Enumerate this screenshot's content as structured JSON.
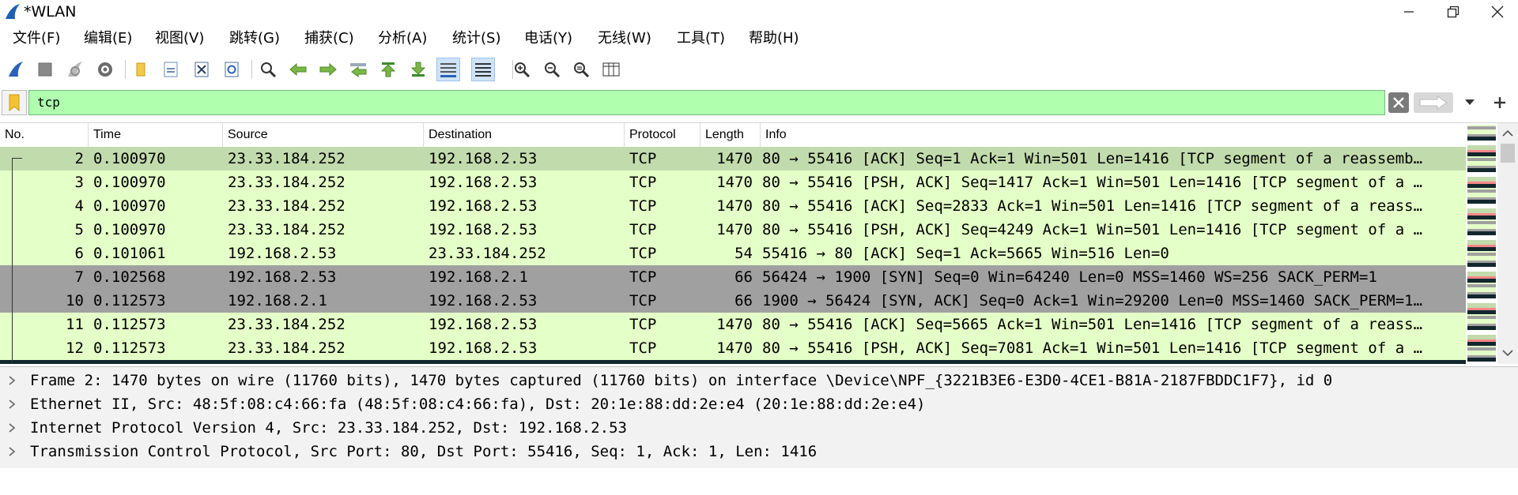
{
  "window": {
    "title": "*WLAN"
  },
  "menu": [
    "文件(F)",
    "编辑(E)",
    "视图(V)",
    "跳转(G)",
    "捕获(C)",
    "分析(A)",
    "统计(S)",
    "电话(Y)",
    "无线(W)",
    "工具(T)",
    "帮助(H)"
  ],
  "toolbar": {
    "icons": [
      "start-capture-icon",
      "stop-capture-icon",
      "restart-capture-icon",
      "capture-options-icon",
      "open-file-icon",
      "save-file-icon",
      "close-file-icon",
      "reload-file-icon",
      "find-packet-icon",
      "go-back-icon",
      "go-forward-icon",
      "go-to-packet-icon",
      "go-first-packet-icon",
      "go-last-packet-icon",
      "auto-scroll-icon",
      "colorize-icon",
      "zoom-in-icon",
      "zoom-out-icon",
      "normal-size-icon",
      "resize-columns-icon"
    ]
  },
  "filter": {
    "value": "tcp",
    "color": "#afffaf"
  },
  "packet_list": {
    "columns": [
      "No.",
      "Time",
      "Source",
      "Destination",
      "Protocol",
      "Length",
      "Info"
    ],
    "rows": [
      {
        "no": "2",
        "time": "0.100970",
        "source": "23.33.184.252",
        "destination": "192.168.2.53",
        "protocol": "TCP",
        "length": "1470",
        "info": "80 → 55416 [ACK] Seq=1 Ack=1 Win=501 Len=1416 [TCP segment of a reassemb…",
        "bg": "#c2dbac",
        "selected": true
      },
      {
        "no": "3",
        "time": "0.100970",
        "source": "23.33.184.252",
        "destination": "192.168.2.53",
        "protocol": "TCP",
        "length": "1470",
        "info": "80 → 55416 [PSH, ACK] Seq=1417 Ack=1 Win=501 Len=1416 [TCP segment of a …",
        "bg": "#e4ffc7"
      },
      {
        "no": "4",
        "time": "0.100970",
        "source": "23.33.184.252",
        "destination": "192.168.2.53",
        "protocol": "TCP",
        "length": "1470",
        "info": "80 → 55416 [ACK] Seq=2833 Ack=1 Win=501 Len=1416 [TCP segment of a reass…",
        "bg": "#e4ffc7"
      },
      {
        "no": "5",
        "time": "0.100970",
        "source": "23.33.184.252",
        "destination": "192.168.2.53",
        "protocol": "TCP",
        "length": "1470",
        "info": "80 → 55416 [PSH, ACK] Seq=4249 Ack=1 Win=501 Len=1416 [TCP segment of a …",
        "bg": "#e4ffc7"
      },
      {
        "no": "6",
        "time": "0.101061",
        "source": "192.168.2.53",
        "destination": "23.33.184.252",
        "protocol": "TCP",
        "length": "54",
        "info": "55416 → 80 [ACK] Seq=1 Ack=5665 Win=516 Len=0",
        "bg": "#e4ffc7"
      },
      {
        "no": "7",
        "time": "0.102568",
        "source": "192.168.2.53",
        "destination": "192.168.2.1",
        "protocol": "TCP",
        "length": "66",
        "info": "56424 → 1900 [SYN] Seq=0 Win=64240 Len=0 MSS=1460 WS=256 SACK_PERM=1",
        "bg": "#a0a0a0"
      },
      {
        "no": "10",
        "time": "0.112573",
        "source": "192.168.2.1",
        "destination": "192.168.2.53",
        "protocol": "TCP",
        "length": "66",
        "info": "1900 → 56424 [SYN, ACK] Seq=0 Ack=1 Win=29200 Len=0 MSS=1460 SACK_PERM=1…",
        "bg": "#a0a0a0"
      },
      {
        "no": "11",
        "time": "0.112573",
        "source": "23.33.184.252",
        "destination": "192.168.2.53",
        "protocol": "TCP",
        "length": "1470",
        "info": "80 → 55416 [ACK] Seq=5665 Ack=1 Win=501 Len=1416 [TCP segment of a reass…",
        "bg": "#e4ffc7"
      },
      {
        "no": "12",
        "time": "0.112573",
        "source": "23.33.184.252",
        "destination": "192.168.2.53",
        "protocol": "TCP",
        "length": "1470",
        "info": "80 → 55416 [PSH, ACK] Seq=7081 Ack=1 Win=501 Len=1416 [TCP segment of a …",
        "bg": "#e4ffc7"
      }
    ],
    "partial_row_color": "#12272e",
    "partial_row_text_color": "#f78787"
  },
  "details": [
    "Frame 2: 1470 bytes on wire (11760 bits), 1470 bytes captured (11760 bits) on interface \\Device\\NPF_{3221B3E6-E3D0-4CE1-B81A-2187FBDDC1F7}, id 0",
    "Ethernet II, Src: 48:5f:08:c4:66:fa (48:5f:08:c4:66:fa), Dst: 20:1e:88:dd:2e:e4 (20:1e:88:dd:2e:e4)",
    "Internet Protocol Version 4, Src: 23.33.184.252, Dst: 192.168.2.53",
    "Transmission Control Protocol, Src Port: 80, Dst Port: 55416, Seq: 1, Ack: 1, Len: 1416"
  ]
}
